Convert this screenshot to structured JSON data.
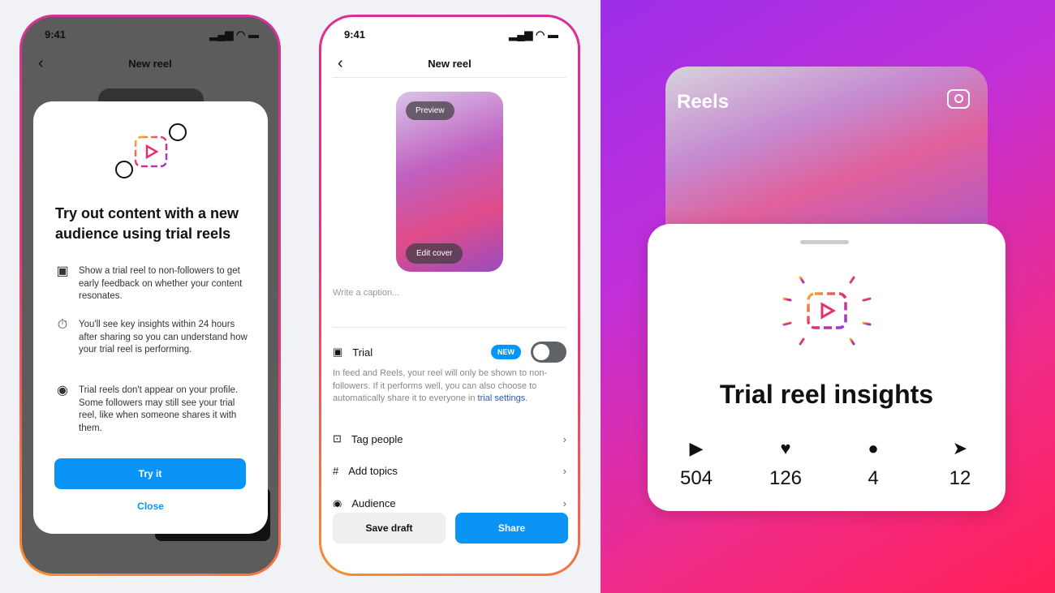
{
  "phone1": {
    "time": "9:41",
    "nav_title": "New reel",
    "modal": {
      "title": "Try out content with a new audience using trial reels",
      "features": [
        {
          "icon": "trial-reel-icon",
          "text": "Show a trial reel to non-followers to get early feedback on whether your content resonates."
        },
        {
          "icon": "stopwatch-icon",
          "text": "You'll see key insights within 24 hours after sharing so you can understand how your trial reel is performing."
        },
        {
          "icon": "profile-icon",
          "text": "Trial reels don't appear on your profile. Some followers may still see your trial reel, like when someone shares it with them."
        }
      ],
      "primary_button": "Try it",
      "secondary_button": "Close"
    }
  },
  "phone2": {
    "time": "9:41",
    "nav_title": "New reel",
    "preview_label": "Preview",
    "edit_cover_label": "Edit cover",
    "caption_placeholder": "Write a caption...",
    "trial": {
      "label": "Trial",
      "badge": "NEW",
      "toggle_on": false,
      "description": "In feed and Reels, your reel will only be shown to non-followers. If it performs well, you can also choose to automatically share it to everyone in ",
      "link": "trial settings",
      "end": "."
    },
    "rows": [
      {
        "label": "Tag people",
        "icon": "tag-people-icon"
      },
      {
        "label": "Add topics",
        "icon": "hashtag-icon"
      },
      {
        "label": "Audience",
        "icon": "eye-icon"
      }
    ],
    "save_draft": "Save draft",
    "share": "Share"
  },
  "insights": {
    "header": "Reels",
    "title": "Trial reel insights",
    "stats": [
      {
        "icon": "play-icon",
        "value": "504"
      },
      {
        "icon": "heart-icon",
        "value": "126"
      },
      {
        "icon": "comment-icon",
        "value": "4"
      },
      {
        "icon": "share-icon",
        "value": "12"
      }
    ]
  },
  "colors": {
    "accent": "#0a95f6",
    "gradient_start": "#9d2ee8",
    "gradient_end": "#ff1f55"
  }
}
